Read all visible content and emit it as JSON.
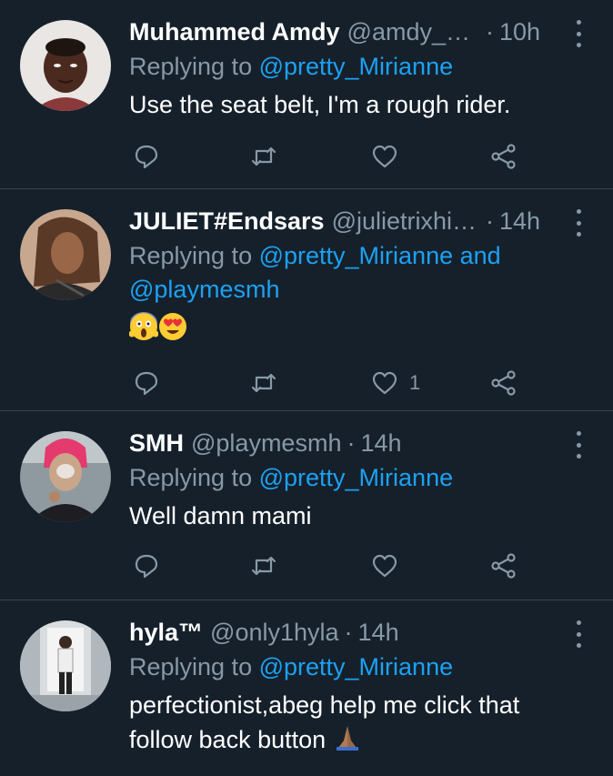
{
  "tweets": [
    {
      "name": "Muhammed Amdy",
      "handle": "@amdy_of...",
      "dot": "·",
      "time": "10h",
      "reply_prefix": "Replying to",
      "reply_to": "@pretty_Mirianne",
      "reply_joiner": "",
      "reply_to_2": "",
      "text": "Use the seat belt, I'm a rough rider.",
      "like_count": ""
    },
    {
      "name": "JULIET#Endsars",
      "handle": "@julietrixhin...",
      "dot": "·",
      "time": "14h",
      "reply_prefix": "Replying to",
      "reply_to": "@pretty_Mirianne",
      "reply_joiner": "and",
      "reply_to_2": "@playmesmh",
      "text": "",
      "emojis": [
        "face-screaming-in-fear-emoji",
        "heart-eyes-emoji"
      ],
      "like_count": "1"
    },
    {
      "name": "SMH",
      "handle": "@playmesmh",
      "dot": "·",
      "time": "14h",
      "reply_prefix": "Replying to",
      "reply_to": "@pretty_Mirianne",
      "reply_joiner": "",
      "reply_to_2": "",
      "text": "Well damn mami",
      "like_count": ""
    },
    {
      "name": "hyla™",
      "handle": "@only1hyla",
      "dot": "·",
      "time": "14h",
      "reply_prefix": "Replying to",
      "reply_to": "@pretty_Mirianne",
      "reply_joiner": "",
      "reply_to_2": "",
      "text_line1": "perfectionist,abeg help me click that",
      "text_line2": "follow back button",
      "emojis": [
        "folded-hands-emoji"
      ],
      "like_count": ""
    }
  ],
  "icons": {
    "reply": "reply-icon",
    "retweet": "retweet-icon",
    "like": "like-icon",
    "share": "share-icon",
    "more": "more-options-icon"
  },
  "colors": {
    "background": "#15202b",
    "secondary_text": "#8899a6",
    "mention": "#1da1f2",
    "divider": "#38444d"
  }
}
